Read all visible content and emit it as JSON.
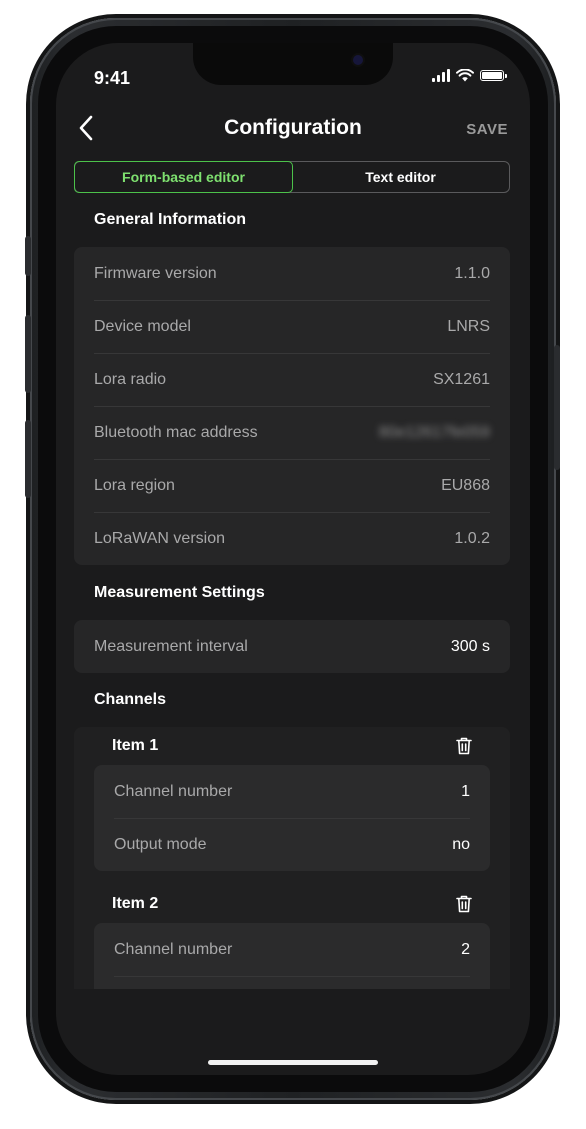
{
  "status_bar": {
    "time": "9:41"
  },
  "nav": {
    "title": "Configuration",
    "save_label": "SAVE",
    "back_icon": "chevron-left-icon"
  },
  "tabs": [
    {
      "label": "Form-based editor",
      "active": true
    },
    {
      "label": "Text editor",
      "active": false
    }
  ],
  "general": {
    "title": "General Information",
    "rows": [
      {
        "label": "Firmware version",
        "value": "1.1.0"
      },
      {
        "label": "Device model",
        "value": "LNRS"
      },
      {
        "label": "Lora radio",
        "value": "SX1261"
      },
      {
        "label": "Bluetooth mac address",
        "value": "80e12617fe059"
      },
      {
        "label": "Lora region",
        "value": "EU868"
      },
      {
        "label": "LoRaWAN version",
        "value": "1.0.2"
      }
    ]
  },
  "measurement": {
    "title": "Measurement Settings",
    "rows": [
      {
        "label": "Measurement interval",
        "value": "300 s"
      }
    ]
  },
  "channels": {
    "title": "Channels",
    "items": [
      {
        "title": "Item 1",
        "rows": [
          {
            "label": "Channel number",
            "value": "1"
          },
          {
            "label": "Output mode",
            "value": "no"
          }
        ]
      },
      {
        "title": "Item 2",
        "rows": [
          {
            "label": "Channel number",
            "value": "2"
          }
        ]
      }
    ]
  },
  "colors": {
    "accent": "#4cc24a",
    "background": "#1b1b1c",
    "card": "#262627"
  }
}
